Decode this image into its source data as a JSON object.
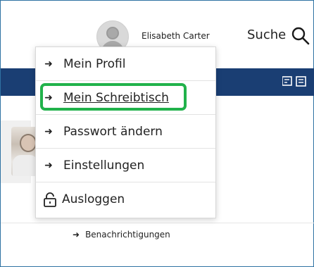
{
  "header": {
    "user_name": "Elisabeth Carter",
    "search_label": "Suche",
    "search_icon": "search-icon",
    "avatar_icon": "user-avatar-icon"
  },
  "user_menu": {
    "items": [
      {
        "label": "Mein Profil",
        "icon": "arrow-right-icon"
      },
      {
        "label": "Mein Schreibtisch",
        "icon": "arrow-right-icon",
        "active": true
      },
      {
        "label": "Passwort ändern",
        "icon": "arrow-right-icon"
      },
      {
        "label": "Einstellungen",
        "icon": "arrow-right-icon"
      },
      {
        "label": "Ausloggen",
        "icon": "lock-icon"
      }
    ],
    "highlight_color": "#21b24b"
  },
  "nav": {
    "background": "#1a3e73"
  },
  "main": {
    "notifications_link": "Benachrichtigungen"
  }
}
